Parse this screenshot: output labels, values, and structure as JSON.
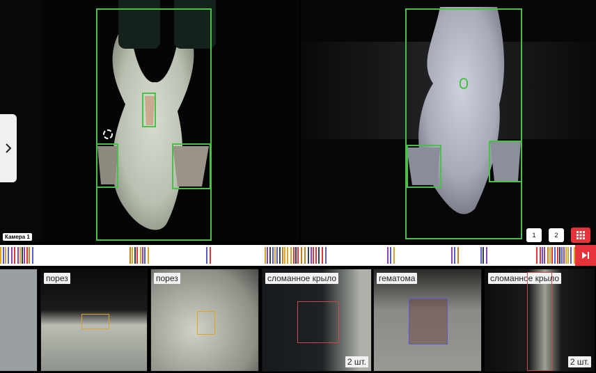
{
  "camera": {
    "label": "Камера 1",
    "pages": [
      "1",
      "2"
    ]
  },
  "colors": {
    "accent": "#e6333a",
    "detection": "#49c146",
    "cut_box": "#d9a52a",
    "broken_wing_box": "#c84a4a",
    "hematoma_box": "#5a5ad0"
  },
  "icons": {
    "side_toggle": "chevron-right-icon",
    "grid": "grid-icon",
    "timeline_end": "skip-end-icon",
    "camera_cursor": "rotate-icon"
  },
  "thumbnails": [
    {
      "label": "",
      "count": ""
    },
    {
      "label": "порез",
      "count": ""
    },
    {
      "label": "порез",
      "count": ""
    },
    {
      "label": "сломанное крыло",
      "count": "2 шт."
    },
    {
      "label": "гематома",
      "count": ""
    },
    {
      "label": "сломанное крыло",
      "count": "2 шт."
    }
  ]
}
